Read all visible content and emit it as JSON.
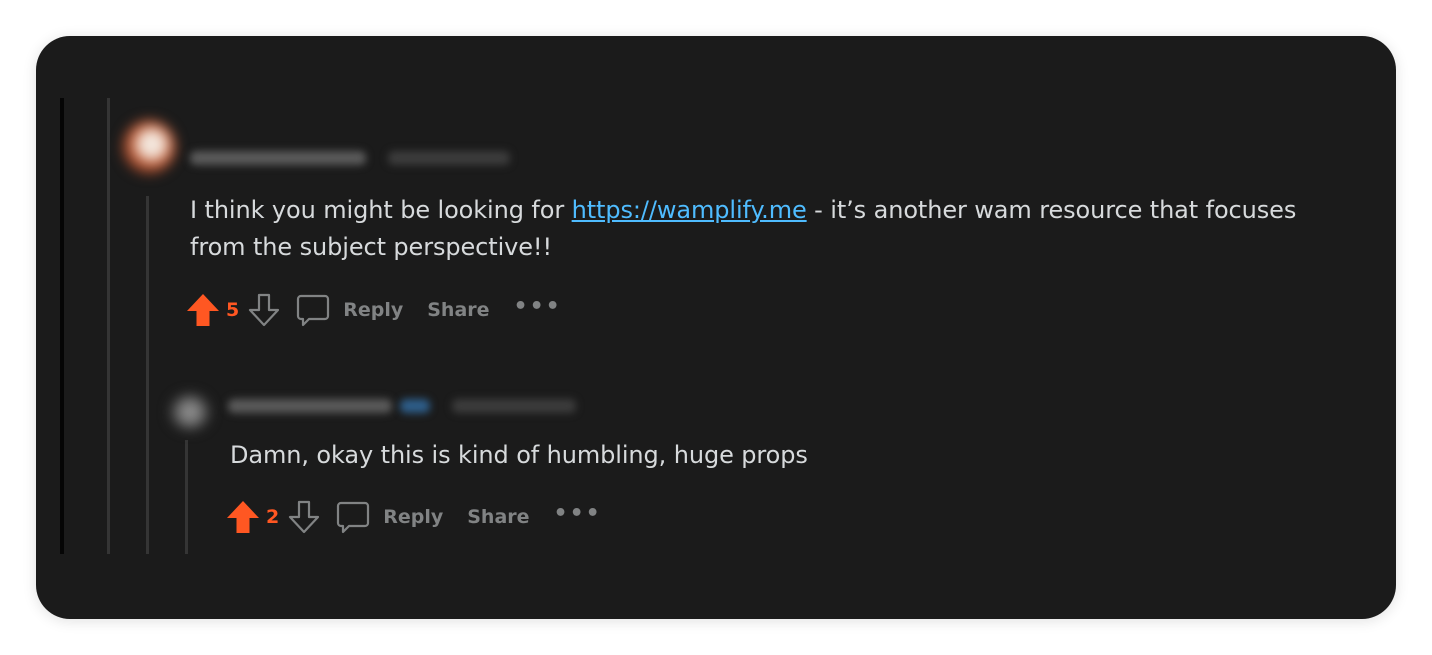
{
  "comments": [
    {
      "body_prefix": "I think you might be looking for ",
      "link_text": "https://wamplify.me",
      "body_line1_suffix": " - it’s another wam resource that focuses",
      "body_line2": "from the subject perspective!!",
      "score": "5",
      "reply_label": "Reply",
      "share_label": "Share",
      "more_label": "•••"
    },
    {
      "body": "Damn, okay this is kind of humbling, huge props",
      "score": "2",
      "reply_label": "Reply",
      "share_label": "Share",
      "more_label": "•••"
    }
  ],
  "colors": {
    "background": "#1b1b1b",
    "text": "#d7dadc",
    "link": "#4fbcff",
    "upvote": "#ff5722",
    "muted": "#818384"
  },
  "icons": [
    "upvote-arrow-icon",
    "downvote-arrow-icon",
    "comment-bubble-icon",
    "more-options-icon"
  ]
}
